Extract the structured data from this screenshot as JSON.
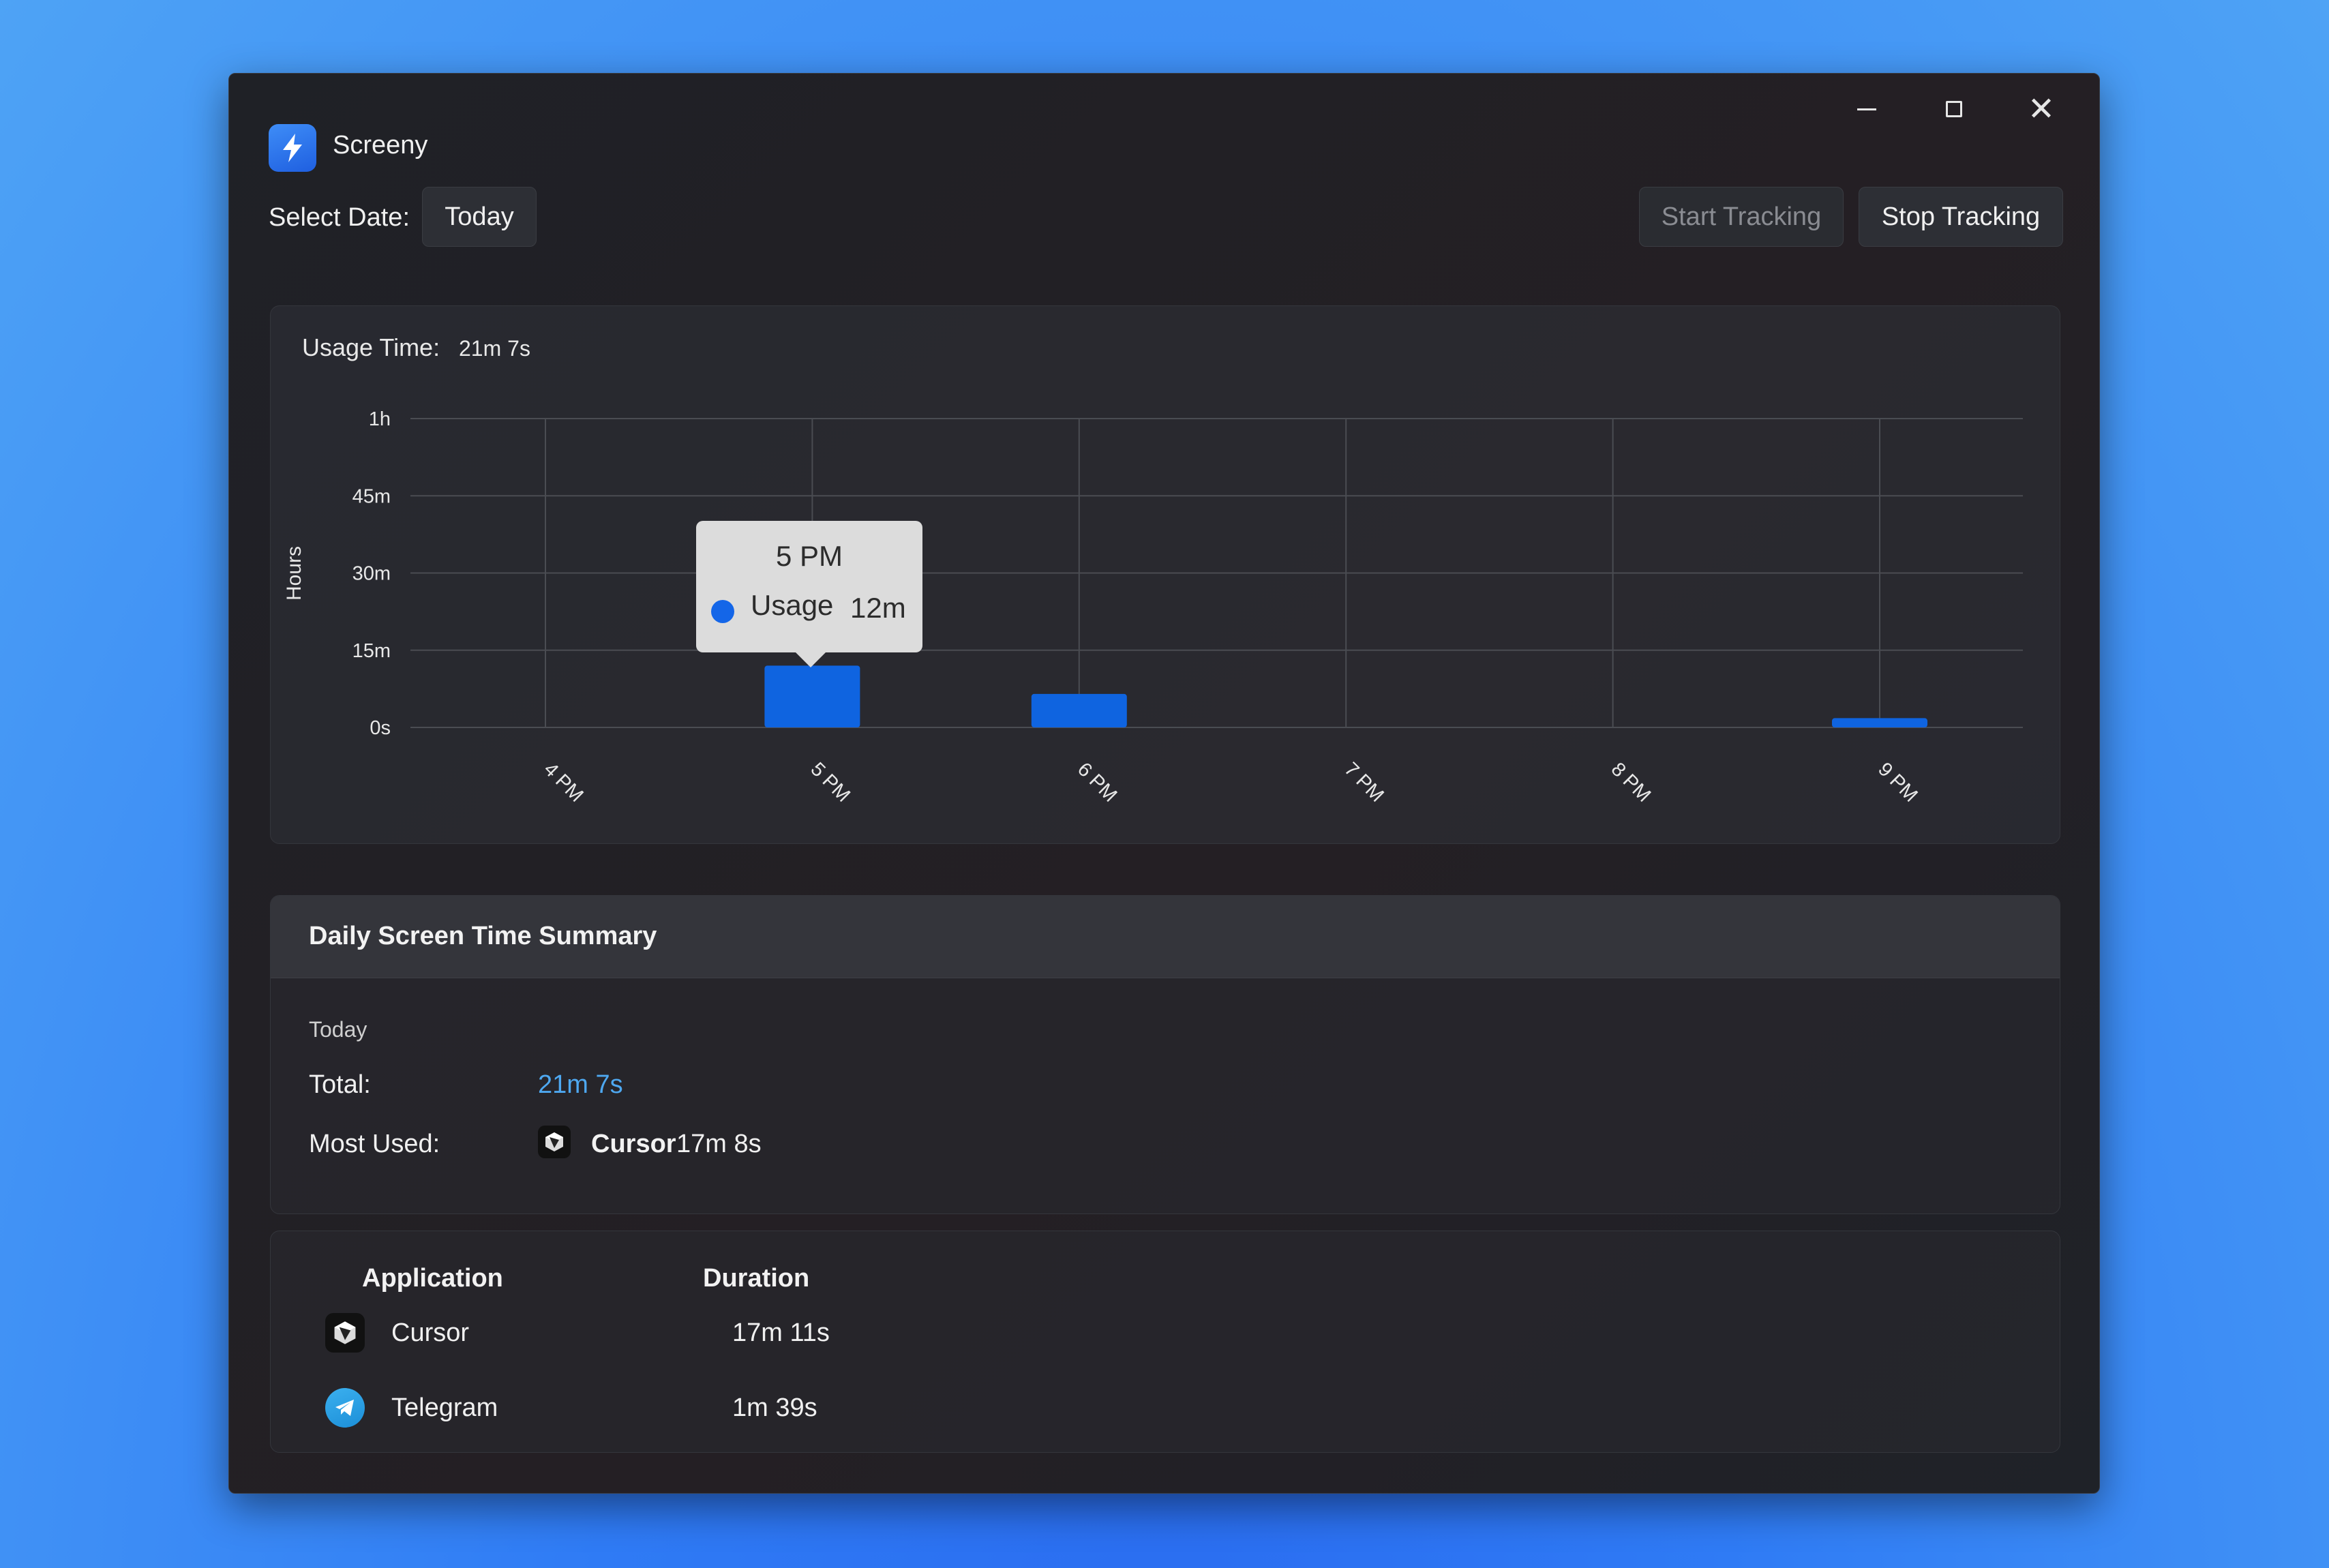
{
  "app": {
    "title": "Screeny"
  },
  "toolbar": {
    "date_label": "Select Date:",
    "date_value": "Today",
    "start_label": "Start Tracking",
    "stop_label": "Stop Tracking"
  },
  "usage": {
    "label": "Usage Time:",
    "value": "21m 7s"
  },
  "chart_data": {
    "type": "bar",
    "ylabel": "Hours",
    "xlabel": "",
    "categories": [
      "4 PM",
      "5 PM",
      "6 PM",
      "7 PM",
      "8 PM",
      "9 PM"
    ],
    "y_ticks": [
      "0s",
      "15m",
      "30m",
      "45m",
      "1h"
    ],
    "ylim_minutes": [
      0,
      60
    ],
    "series": [
      {
        "name": "Usage",
        "values_minutes": [
          0,
          12,
          6.5,
          0,
          0,
          1.8
        ]
      }
    ],
    "grid": true,
    "tooltip": {
      "title": "5 PM",
      "series": "Usage",
      "value": "12m"
    },
    "colors": {
      "bar": "#0f64e0",
      "grid": "#4a4c52"
    }
  },
  "summary": {
    "title": "Daily Screen Time Summary",
    "day": "Today",
    "total_label": "Total:",
    "total_value": "21m 7s",
    "most_used_label": "Most Used:",
    "most_used_app": "Cursor",
    "most_used_duration": "17m 8s"
  },
  "table": {
    "headers": {
      "application": "Application",
      "duration": "Duration"
    },
    "rows": [
      {
        "app": "Cursor",
        "duration": "17m 11s",
        "icon": "cursor-icon"
      },
      {
        "app": "Telegram",
        "duration": "1m 39s",
        "icon": "telegram-icon"
      }
    ]
  }
}
